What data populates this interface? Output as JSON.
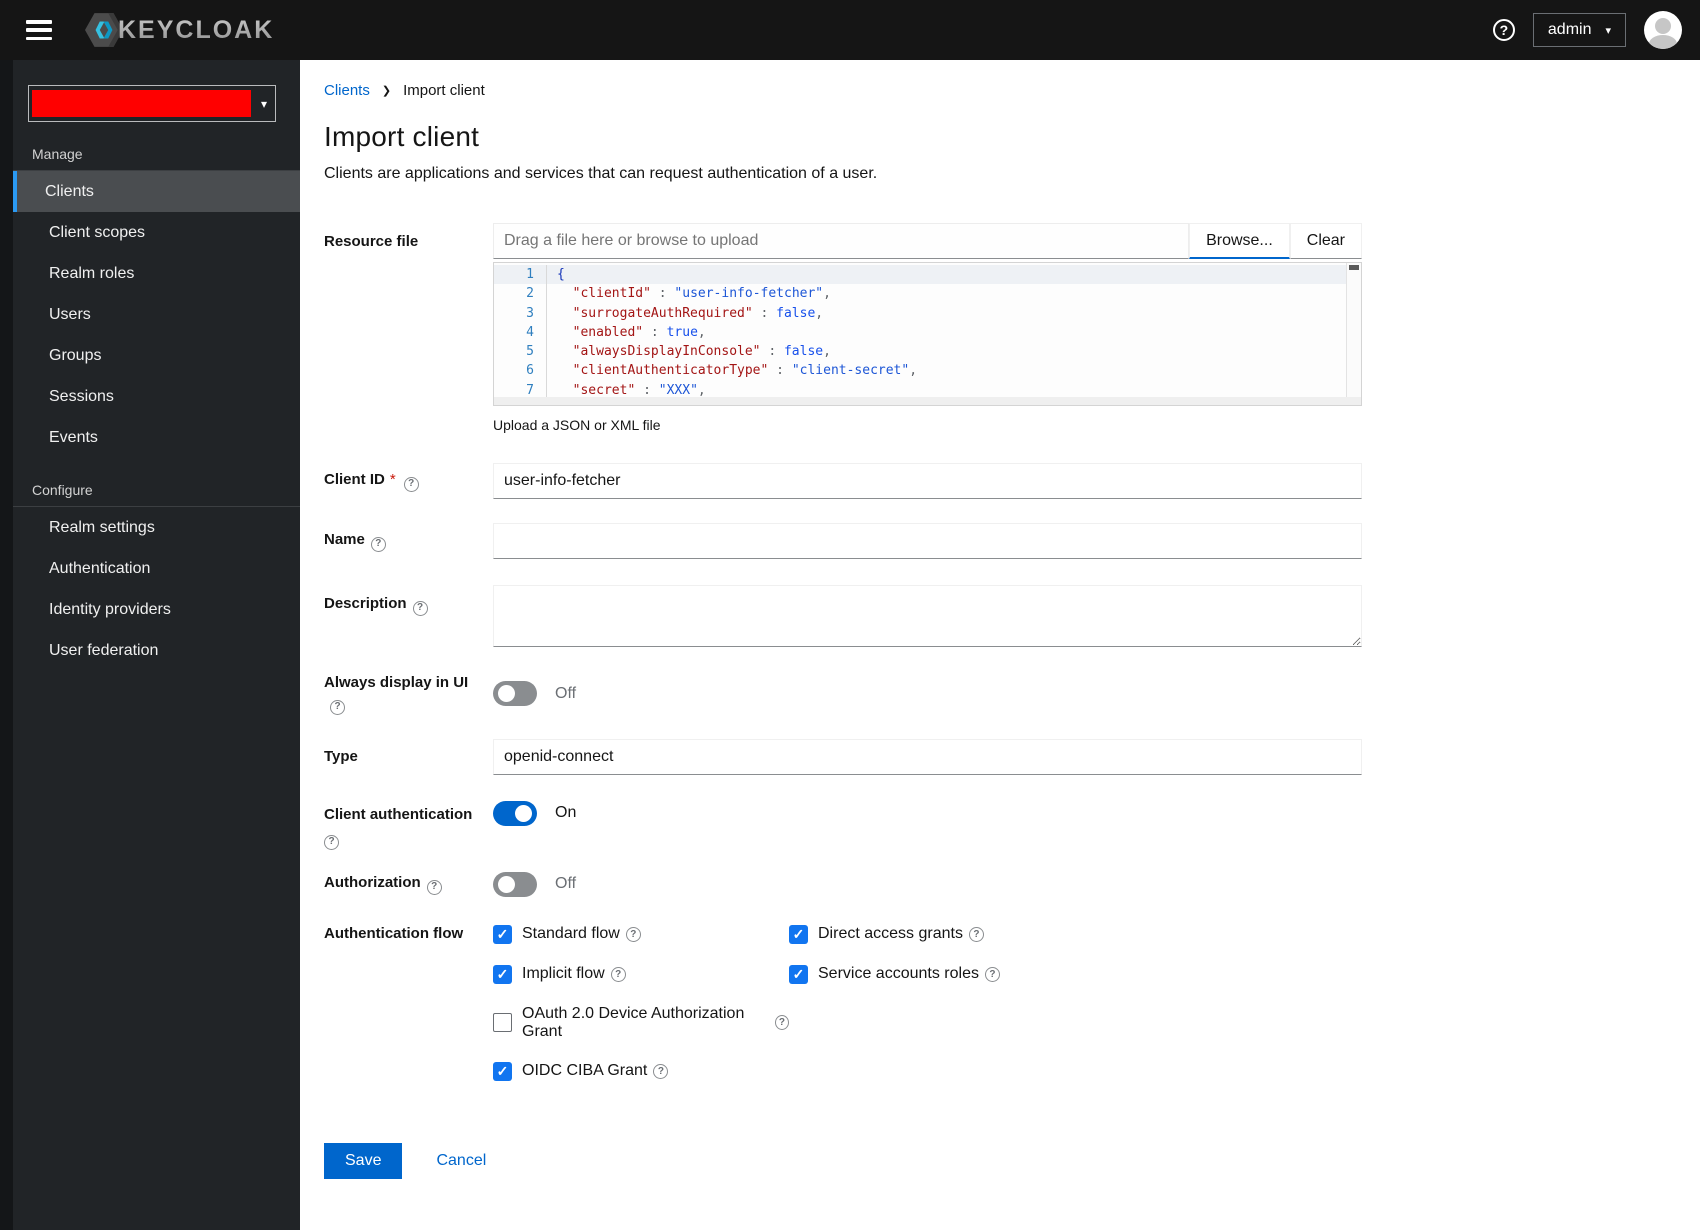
{
  "header": {
    "brand": "KEYCLOAK",
    "user_menu": "admin"
  },
  "sidebar": {
    "sections": [
      {
        "label": "Manage",
        "items": [
          "Clients",
          "Client scopes",
          "Realm roles",
          "Users",
          "Groups",
          "Sessions",
          "Events"
        ]
      },
      {
        "label": "Configure",
        "items": [
          "Realm settings",
          "Authentication",
          "Identity providers",
          "User federation"
        ]
      }
    ],
    "active_item": "Clients",
    "realm_selector_color": "#ff0000"
  },
  "breadcrumb": {
    "link": "Clients",
    "current": "Import client"
  },
  "page": {
    "title": "Import client",
    "subtitle": "Clients are applications and services that can request authentication of a user."
  },
  "form": {
    "resource_file": {
      "label": "Resource file",
      "placeholder": "Drag a file here or browse to upload",
      "browse_label": "Browse...",
      "clear_label": "Clear",
      "helper": "Upload a JSON or XML file",
      "code_lines": [
        {
          "num": "1",
          "tokens": [
            {
              "c": "brace",
              "t": "{"
            }
          ]
        },
        {
          "num": "2",
          "tokens": [
            {
              "c": "p",
              "t": "  "
            },
            {
              "c": "key",
              "t": "\"clientId\""
            },
            {
              "c": "p",
              "t": " : "
            },
            {
              "c": "str",
              "t": "\"user-info-fetcher\""
            },
            {
              "c": "p",
              "t": ","
            }
          ]
        },
        {
          "num": "3",
          "tokens": [
            {
              "c": "p",
              "t": "  "
            },
            {
              "c": "key",
              "t": "\"surrogateAuthRequired\""
            },
            {
              "c": "p",
              "t": " : "
            },
            {
              "c": "bool",
              "t": "false"
            },
            {
              "c": "p",
              "t": ","
            }
          ]
        },
        {
          "num": "4",
          "tokens": [
            {
              "c": "p",
              "t": "  "
            },
            {
              "c": "key",
              "t": "\"enabled\""
            },
            {
              "c": "p",
              "t": " : "
            },
            {
              "c": "bool",
              "t": "true"
            },
            {
              "c": "p",
              "t": ","
            }
          ]
        },
        {
          "num": "5",
          "tokens": [
            {
              "c": "p",
              "t": "  "
            },
            {
              "c": "key",
              "t": "\"alwaysDisplayInConsole\""
            },
            {
              "c": "p",
              "t": " : "
            },
            {
              "c": "bool",
              "t": "false"
            },
            {
              "c": "p",
              "t": ","
            }
          ]
        },
        {
          "num": "6",
          "tokens": [
            {
              "c": "p",
              "t": "  "
            },
            {
              "c": "key",
              "t": "\"clientAuthenticatorType\""
            },
            {
              "c": "p",
              "t": " : "
            },
            {
              "c": "str",
              "t": "\"client-secret\""
            },
            {
              "c": "p",
              "t": ","
            }
          ]
        },
        {
          "num": "7",
          "tokens": [
            {
              "c": "p",
              "t": "  "
            },
            {
              "c": "key",
              "t": "\"secret\""
            },
            {
              "c": "p",
              "t": " : "
            },
            {
              "c": "str",
              "t": "\"XXX\""
            },
            {
              "c": "p",
              "t": ","
            }
          ]
        }
      ]
    },
    "client_id": {
      "label": "Client ID",
      "required_mark": "*",
      "value": "user-info-fetcher"
    },
    "name": {
      "label": "Name",
      "value": ""
    },
    "description": {
      "label": "Description",
      "value": ""
    },
    "always_display": {
      "label": "Always display in UI",
      "state": "Off"
    },
    "type": {
      "label": "Type",
      "value": "openid-connect"
    },
    "client_auth": {
      "label": "Client authentication",
      "state": "On"
    },
    "authorization": {
      "label": "Authorization",
      "state": "Off"
    },
    "auth_flow": {
      "label": "Authentication flow",
      "options": [
        {
          "label": "Standard flow",
          "checked": true
        },
        {
          "label": "Direct access grants",
          "checked": true
        },
        {
          "label": "Implicit flow",
          "checked": true
        },
        {
          "label": "Service accounts roles",
          "checked": true
        },
        {
          "label": "OAuth 2.0 Device Authorization Grant",
          "checked": false
        },
        {
          "label": "OIDC CIBA Grant",
          "checked": true
        }
      ]
    },
    "actions": {
      "save": "Save",
      "cancel": "Cancel"
    }
  },
  "colors": {
    "primary": "#0066cc",
    "checkbox": "#1175f0",
    "nav_accent": "#2b9af3",
    "redaction": "#ff0000",
    "required": "#c9190b"
  }
}
